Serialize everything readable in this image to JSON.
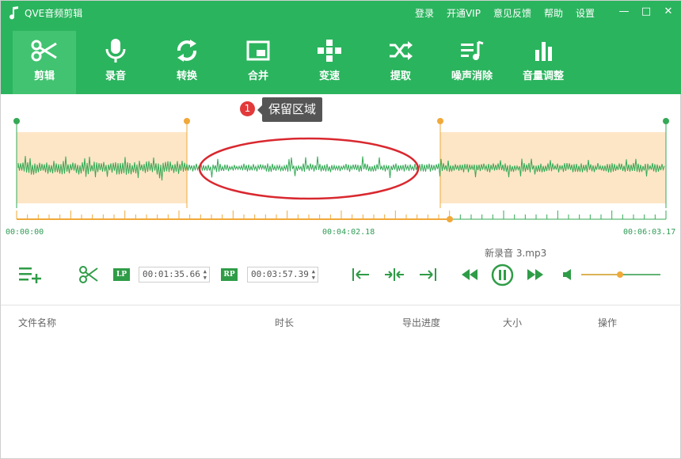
{
  "app": {
    "title": "QVE音频剪辑"
  },
  "top_menu": [
    "登录",
    "开通VIP",
    "意见反馈",
    "帮助",
    "设置"
  ],
  "window_controls": {
    "minimize": "—",
    "maximize": "□",
    "close": "✕"
  },
  "toolbar": {
    "active_index": 0,
    "tools": [
      {
        "label": "剪辑",
        "icon": "scissors-icon"
      },
      {
        "label": "录音",
        "icon": "microphone-icon"
      },
      {
        "label": "转换",
        "icon": "refresh-icon"
      },
      {
        "label": "合并",
        "icon": "merge-window-icon"
      },
      {
        "label": "变速",
        "icon": "speed-icon"
      },
      {
        "label": "提取",
        "icon": "shuffle-icon"
      },
      {
        "label": "噪声消除",
        "icon": "noise-reduction-icon"
      },
      {
        "label": "音量调整",
        "icon": "volume-bars-icon"
      }
    ]
  },
  "waveform": {
    "tooltip": {
      "badge": "1",
      "text": "保留区域"
    },
    "time_start": "00:00:00",
    "time_current": "00:04:02.18",
    "time_end": "00:06:03.17",
    "playhead_fraction": 0.667,
    "left_trim_fraction": 0.262,
    "right_trim_fraction": 0.652
  },
  "controls": {
    "lp_label": "LP",
    "rp_label": "RP",
    "lp_time": "00:01:35.66",
    "rp_time": "00:03:57.39",
    "file_name": "新录音 3.mp3",
    "volume_fraction": 0.49
  },
  "table": {
    "columns": [
      "文件名称",
      "时长",
      "导出进度",
      "大小",
      "操作"
    ]
  },
  "colors": {
    "brand_green": "#2bb45e",
    "waveform_green": "#35a956",
    "trim_orange": "#f0a93a",
    "trim_fill": "#fde6c6",
    "annotation_red": "#d9282f"
  }
}
